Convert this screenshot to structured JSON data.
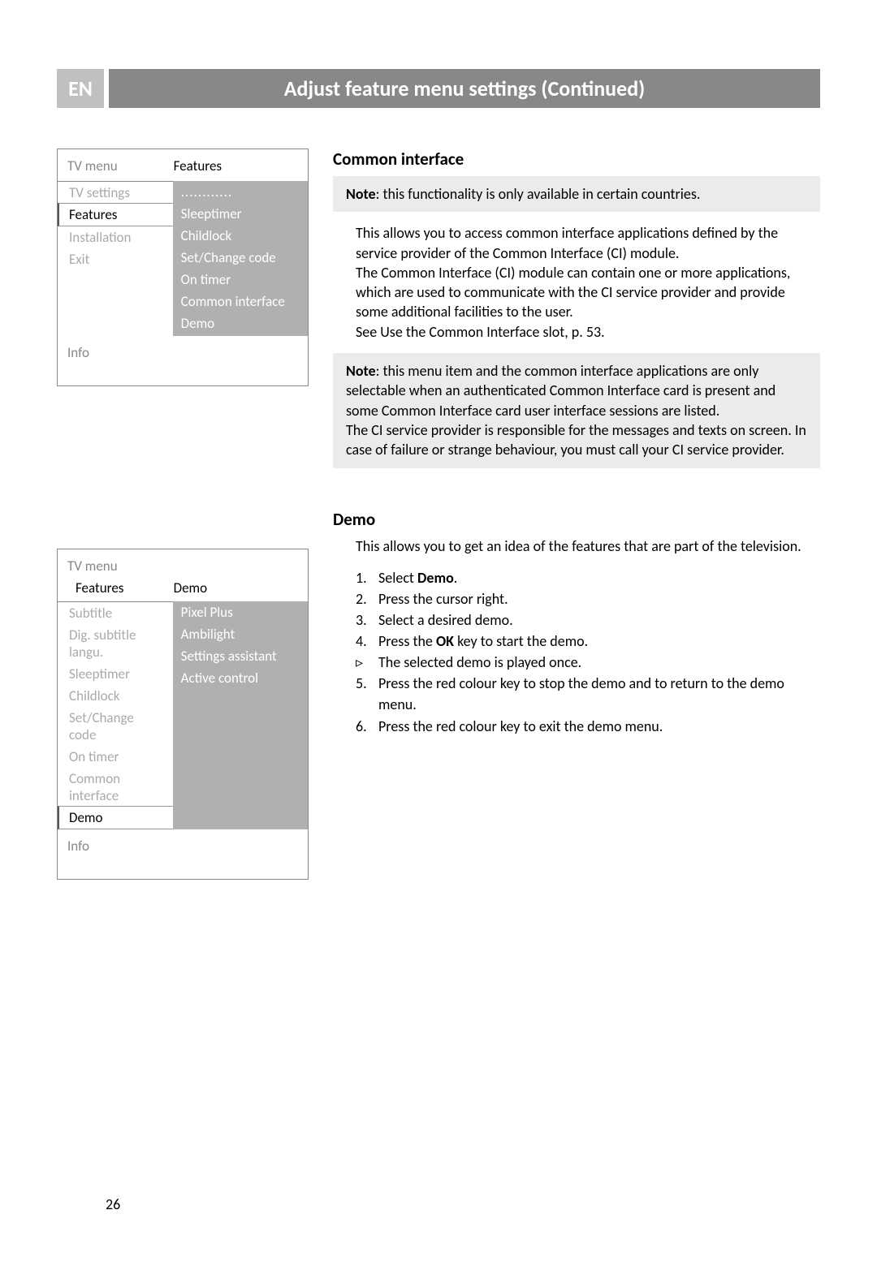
{
  "lang_badge": "EN",
  "page_title": "Adjust feature menu settings  (Continued)",
  "page_number": "26",
  "menu1": {
    "header_left": "TV menu",
    "header_right": "Features",
    "left_items": [
      "TV settings",
      "Features",
      "Installation",
      "Exit"
    ],
    "left_selected_index": 1,
    "right_items": [
      "............",
      "Sleeptimer",
      "Childlock",
      "Set/Change code",
      "On timer",
      "Common interface",
      "Demo"
    ],
    "footer": "Info"
  },
  "menu2": {
    "header_left": "TV menu",
    "sub_left": "Features",
    "sub_right": "Demo",
    "left_items": [
      "Subtitle",
      "Dig. subtitle langu.",
      "Sleeptimer",
      "Childlock",
      "Set/Change code",
      "On timer",
      "Common interface",
      "Demo"
    ],
    "left_selected_index": 7,
    "right_items": [
      "Pixel Plus",
      "Ambilight",
      "Settings assistant",
      "Active control"
    ],
    "footer": "Info"
  },
  "section_ci": {
    "title": "Common interface",
    "note1_prefix": "Note",
    "note1_text": ": this functionality is only available in certain countries.",
    "para1": "This allows you to access common interface applications defined by the service provider of the Common Interface (CI) module.",
    "para2": "The Common Interface (CI) module can contain one or more applications, which are used to communicate with the CI service provider and provide some additional facilities to the user.",
    "para3": "See Use the Common Interface slot, p. 53.",
    "note2_prefix": "Note",
    "note2_text1": ": this menu item and the common interface applications are only selectable when an authenticated Common Interface card is present and some Common Interface card user interface sessions are listed.",
    "note2_text2": "The CI service provider is responsible for the messages and texts on screen. In case of failure or strange behaviour, you must call your CI service provider."
  },
  "section_demo": {
    "title": "Demo",
    "intro": "This allows you to get an idea of the features that are part of the television.",
    "steps": [
      {
        "n": "1.",
        "pre": "Select ",
        "bold": "Demo",
        "post": "."
      },
      {
        "n": "2.",
        "text": "Press the cursor right."
      },
      {
        "n": "3.",
        "text": "Select a desired demo."
      },
      {
        "n": "4.",
        "pre": "Press the ",
        "bold": "OK",
        "post": " key to start the demo."
      },
      {
        "n": "▹",
        "text": "The selected demo is played once."
      },
      {
        "n": "5.",
        "text": "Press the red colour key to stop the demo and to return to the demo menu."
      },
      {
        "n": "6.",
        "text": "Press the red colour key to exit the demo menu."
      }
    ]
  }
}
